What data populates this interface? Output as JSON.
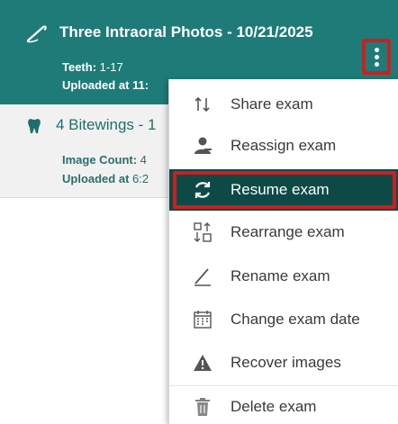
{
  "colors": {
    "accent": "#1f7b78",
    "selected": "#0d4a47",
    "highlight": "#cc1f1f"
  },
  "exams": [
    {
      "icon": "probe-icon",
      "title": "Three Intraoral Photos - 10/21/2025",
      "meta1_key": "Teeth:",
      "meta1_value": " 1-17",
      "meta2_text": "Uploaded at 11:"
    },
    {
      "icon": "tooth-icon",
      "title": "4 Bitewings - 1",
      "meta1_key": "Image Count:",
      "meta1_value": " 4",
      "meta2_key": "Uploaded at",
      "meta2_value": " 6:2"
    }
  ],
  "menu": {
    "items": [
      {
        "icon": "share-sort-icon",
        "label": "Share exam"
      },
      {
        "icon": "reassign-user-icon",
        "label": "Reassign exam"
      },
      {
        "icon": "resume-sync-icon",
        "label": "Resume exam",
        "selected": true
      },
      {
        "icon": "rearrange-icon",
        "label": "Rearrange exam"
      },
      {
        "icon": "pencil-icon",
        "label": "Rename exam"
      },
      {
        "icon": "calendar-icon",
        "label": "Change exam date"
      },
      {
        "icon": "warning-icon",
        "label": "Recover images"
      },
      {
        "icon": "trash-icon",
        "label": "Delete exam"
      }
    ]
  }
}
